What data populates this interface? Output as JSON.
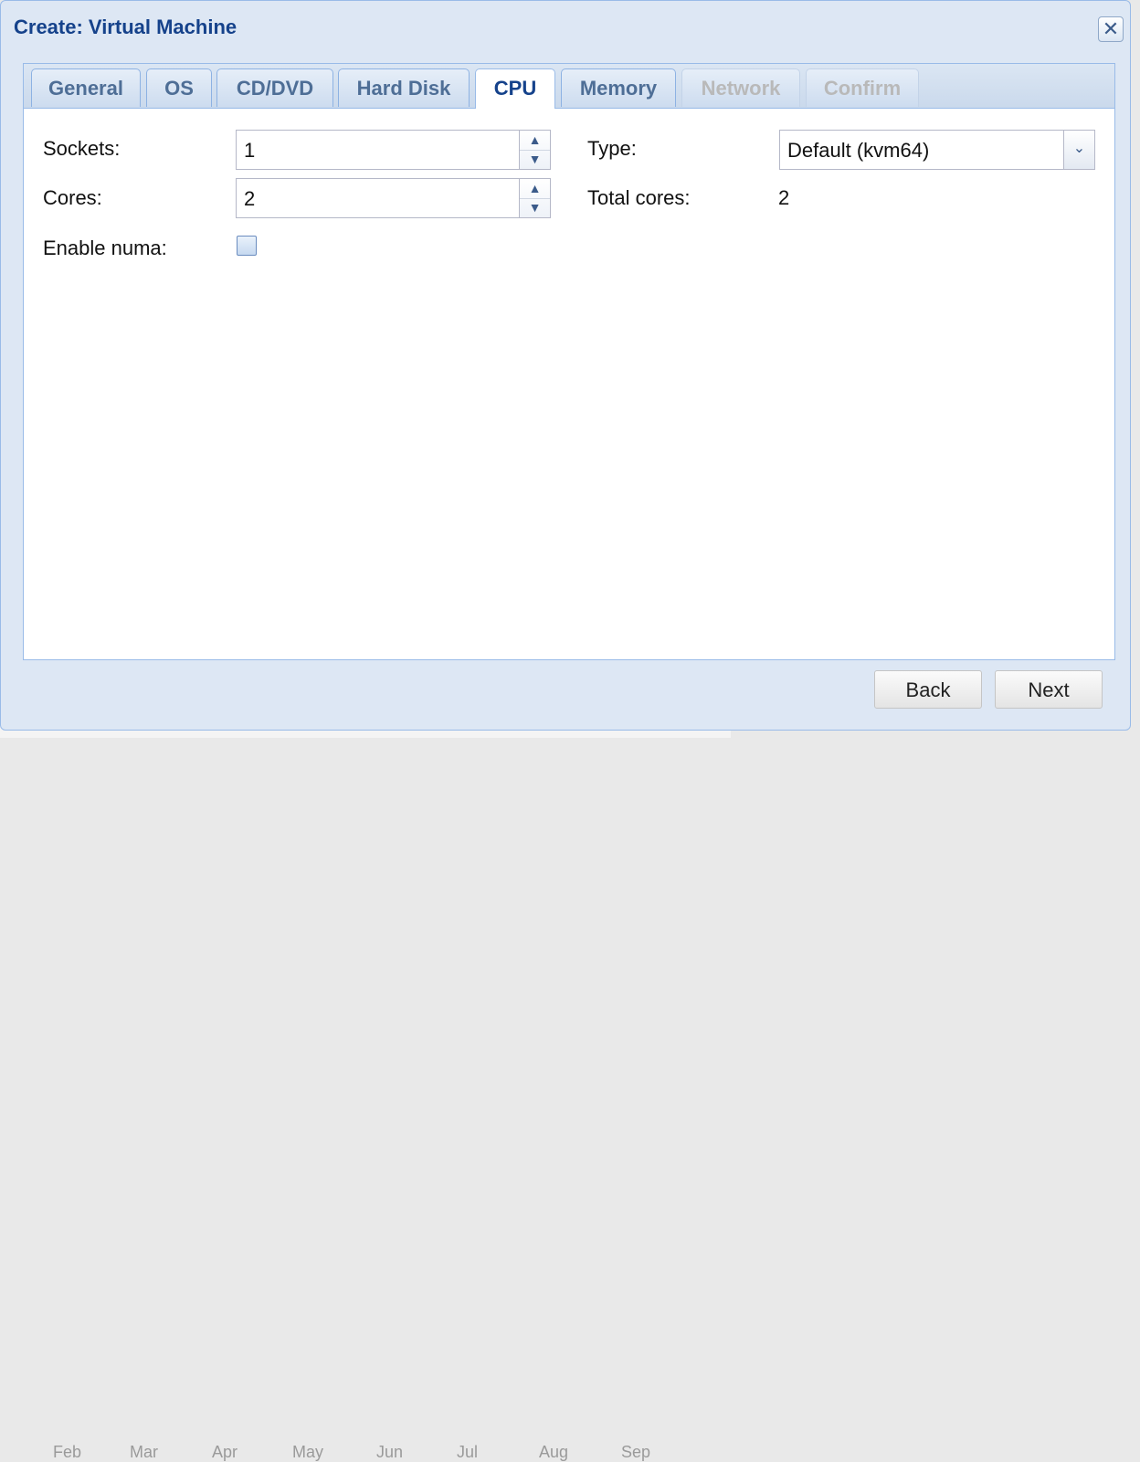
{
  "window": {
    "title": "Create: Virtual Machine",
    "close_icon": "close-icon"
  },
  "tabs": [
    {
      "label": "General",
      "state": "normal"
    },
    {
      "label": "OS",
      "state": "normal"
    },
    {
      "label": "CD/DVD",
      "state": "normal"
    },
    {
      "label": "Hard Disk",
      "state": "normal"
    },
    {
      "label": "CPU",
      "state": "active"
    },
    {
      "label": "Memory",
      "state": "normal"
    },
    {
      "label": "Network",
      "state": "disabled"
    },
    {
      "label": "Confirm",
      "state": "disabled"
    }
  ],
  "form": {
    "sockets_label": "Sockets:",
    "sockets_value": "1",
    "cores_label": "Cores:",
    "cores_value": "2",
    "numa_label": "Enable numa:",
    "numa_checked": false,
    "type_label": "Type:",
    "type_value": "Default (kvm64)",
    "total_cores_label": "Total cores:",
    "total_cores_value": "2"
  },
  "footer": {
    "back_label": "Back",
    "next_label": "Next"
  },
  "background": {
    "axis_labels": [
      "Feb",
      "Mar",
      "Apr",
      "May",
      "Jun",
      "Jul",
      "Aug",
      "Sep"
    ]
  },
  "colors": {
    "title": "#15428b",
    "tab_active_text": "#15428b",
    "tab_text": "#4e6e96",
    "tab_disabled_text": "#b9b9b9",
    "window_bg": "#dde7f4",
    "border": "#99bbe8"
  }
}
